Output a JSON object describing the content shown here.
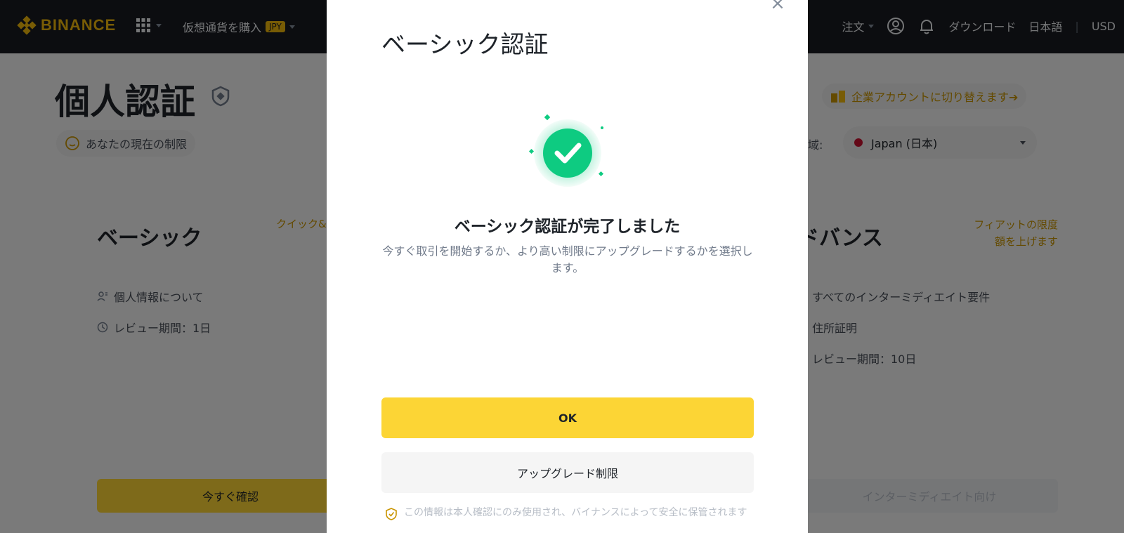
{
  "nav": {
    "logo": "BINANCE",
    "buy_crypto": "仮想通貨を購入",
    "currency_badge": "JPY",
    "orders": "注文",
    "download": "ダウンロード",
    "language": "日本語",
    "separator": "|",
    "fiat": "USD"
  },
  "page": {
    "title": "個人認証",
    "limits_pill": "あなたの現在の制限",
    "business_switch": "企業アカウントに切り替えます➔",
    "region_label": "域:",
    "region_value": "Japan (日本)"
  },
  "cards": {
    "basic": {
      "title": "ベーシック",
      "link": "クイック&",
      "requirements": [
        "個人情報について",
        "レビュー期間：1日"
      ],
      "button": "今すぐ確認"
    },
    "advanced": {
      "title": "ドバンス",
      "link_line1": "フィアットの限度",
      "link_line2": "額を上げます",
      "requirements": [
        "すべてのインターミディエイト要件",
        "住所証明",
        "レビュー期間：10日"
      ],
      "button": "インターミディエイト向け"
    }
  },
  "modal": {
    "title": "ベーシック認証",
    "close": "×",
    "success_title": "ベーシック認証が完了しました",
    "success_desc": "今すぐ取引を開始するか、より高い制限にアップグレードするかを選択します。",
    "ok_button": "OK",
    "upgrade_button": "アップグレード制限",
    "privacy_note": "この情報は本人確認にのみ使用され、バイナンスによって安全に保管されます"
  },
  "colors": {
    "brand": "#f0b90b",
    "primary_button": "#fcd535",
    "success": "#0ecb81"
  }
}
